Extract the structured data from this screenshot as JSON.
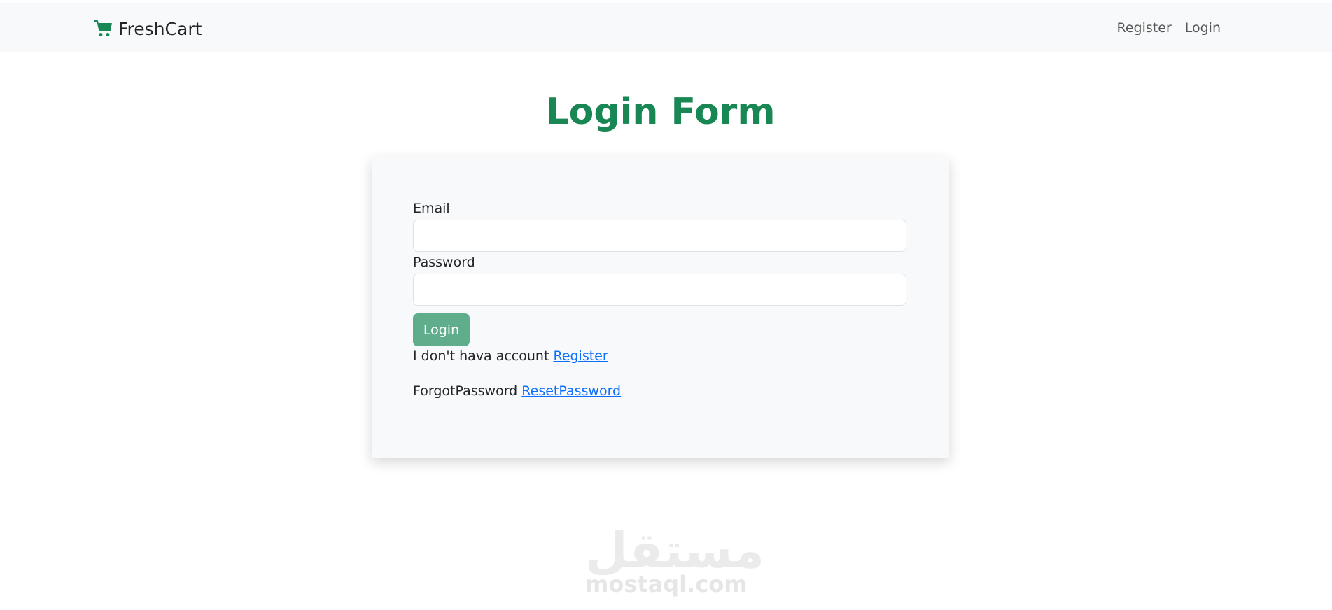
{
  "navbar": {
    "brand_icon": "cart-icon",
    "brand_name": "FreshCart",
    "links": [
      {
        "label": "Register"
      },
      {
        "label": "Login"
      }
    ]
  },
  "page": {
    "title": "Login Form"
  },
  "form": {
    "email_label": "Email",
    "email_value": "",
    "password_label": "Password",
    "password_value": "",
    "submit_label": "Login",
    "no_account_text": "I don't hava account",
    "register_link": "Register",
    "forgot_text": "ForgotPassword",
    "reset_link": "ResetPassword"
  },
  "watermark": {
    "arabic": "مستقل",
    "latin": "mostaql.com"
  },
  "colors": {
    "accent": "#198754",
    "button": "#5fad8b",
    "link": "#0d6efd",
    "navbar_bg": "#f8f9fa"
  }
}
